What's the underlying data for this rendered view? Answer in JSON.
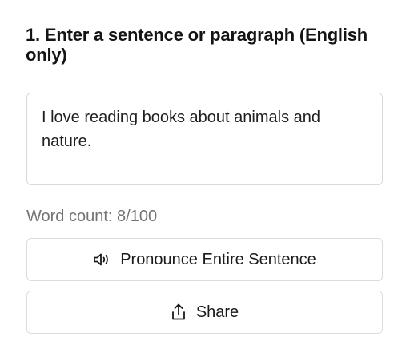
{
  "section": {
    "heading": "1. Enter a sentence or paragraph (English only)"
  },
  "input": {
    "value": "I love reading books about animals and nature."
  },
  "word_count": {
    "text": "Word count: 8/100"
  },
  "buttons": {
    "pronounce": {
      "label": "Pronounce Entire Sentence",
      "icon": "speaker-icon"
    },
    "share": {
      "label": "Share",
      "icon": "share-icon"
    }
  }
}
